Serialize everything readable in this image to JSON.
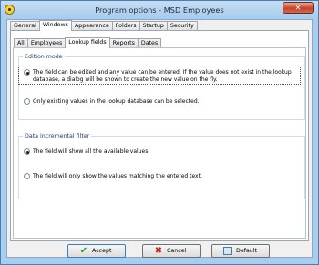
{
  "window": {
    "title": "Program options - MSD Employees",
    "close_label": "✕"
  },
  "main_tabs": [
    {
      "label": "General",
      "active": false
    },
    {
      "label": "Windows",
      "active": true
    },
    {
      "label": "Appearance",
      "active": false
    },
    {
      "label": "Folders",
      "active": false
    },
    {
      "label": "Startup",
      "active": false
    },
    {
      "label": "Security",
      "active": false
    }
  ],
  "sub_tabs": [
    {
      "label": "All",
      "active": false
    },
    {
      "label": "Employees",
      "active": false
    },
    {
      "label": "Lookup fields",
      "active": true
    },
    {
      "label": "Reports",
      "active": false
    },
    {
      "label": "Dates",
      "active": false
    }
  ],
  "edition_mode": {
    "caption": "Edition mode",
    "option1": "The field can be edited and any value can be entered. If the value does not exist in the lookup database, a dialog will be shown to create the new value on the fly.",
    "option1_selected": true,
    "option2": "Only existing values in the lookup database can be selected.",
    "option2_selected": false
  },
  "incremental_filter": {
    "caption": "Data incremental filter",
    "option1": "The field will show all the available values.",
    "option1_selected": true,
    "option2": "The field will only show the values matching the entered text.",
    "option2_selected": false
  },
  "buttons": {
    "accept": "Accept",
    "cancel": "Cancel",
    "default": "Default"
  },
  "icons": {
    "accept": "check-icon",
    "cancel": "cross-icon",
    "default": "document-icon",
    "app": "app-logo-icon"
  }
}
